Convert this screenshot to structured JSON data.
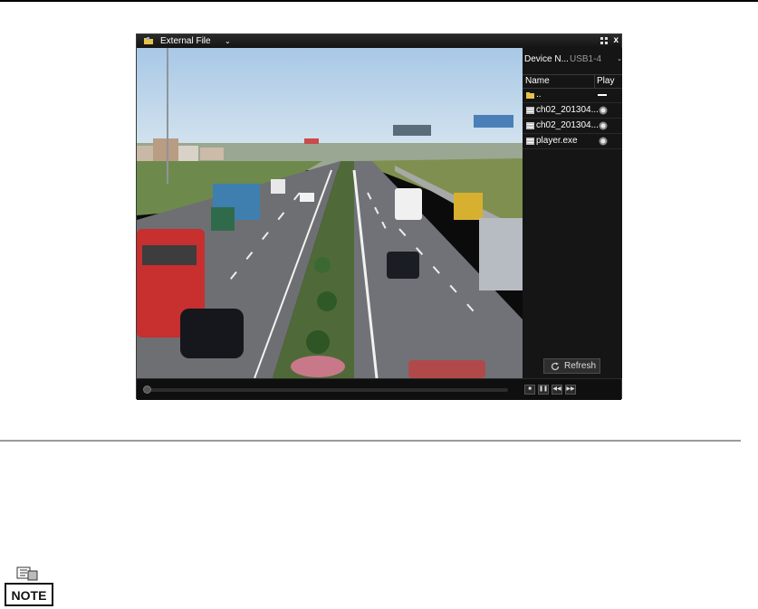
{
  "window": {
    "title": "External File",
    "dropdown_glyph": "⌄"
  },
  "device": {
    "label": "Device N...",
    "selected": "USB1-4"
  },
  "file_list": {
    "columns": [
      "Name",
      "Play"
    ],
    "rows": [
      {
        "name": "..",
        "icon": "folder-icon",
        "play": "none"
      },
      {
        "name": "ch02_201304...",
        "icon": "file-icon",
        "play": "play-icon"
      },
      {
        "name": "ch02_201304...",
        "icon": "file-icon",
        "play": "play-icon"
      },
      {
        "name": "player.exe",
        "icon": "file-icon",
        "play": "play-icon"
      }
    ]
  },
  "buttons": {
    "refresh": "Refresh",
    "close": "x"
  },
  "playback_controls": [
    {
      "name": "stop",
      "glyph": "■"
    },
    {
      "name": "pause",
      "glyph": "❚❚"
    },
    {
      "name": "rewind",
      "glyph": "◀◀"
    },
    {
      "name": "fast-forward",
      "glyph": "▶▶"
    }
  ],
  "progress": 0.0,
  "note_label": "NOTE",
  "colors": {
    "panel_bg": "#151515",
    "titlebar_bg": "#1e1e1e",
    "text": "#ffffff",
    "muted": "#9a9a9a"
  }
}
